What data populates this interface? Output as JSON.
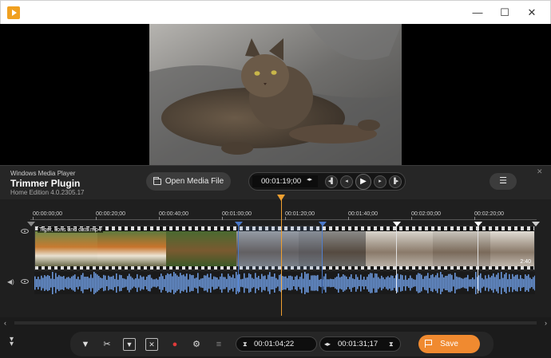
{
  "window": {
    "minimize_glyph": "—",
    "maximize_glyph": "☐",
    "close_glyph": "✕"
  },
  "brand": {
    "product": "Windows Media Player",
    "plugin": "Trimmer Plugin",
    "edition": "Home Edition 4.0.2305.17"
  },
  "controls": {
    "open_label": "Open Media File",
    "current_time": "00:01:19;00",
    "menu_glyph": "☰"
  },
  "timeline": {
    "ticks": [
      "00:00:00;00",
      "00:00:20;00",
      "00:00:40;00",
      "00:01:00;00",
      "00:01:20;00",
      "00:01:40;00",
      "00:02:00;00",
      "00:02:20;00"
    ],
    "clip_name": "Tiger, lions and cats.mp4",
    "clip_duration": "2:40"
  },
  "selection": {
    "start": "00:01:04;22",
    "end": "00:01:31;17"
  },
  "save_label": "Save",
  "colors": {
    "accent": "#f08a30",
    "playhead": "#f0a030",
    "selection_marker": "#4a78c8",
    "waveform": "#6a96d8"
  },
  "icons": [
    "app-icon",
    "folder-icon",
    "frame-step-back-icon",
    "step-back-icon",
    "play-icon",
    "step-forward-icon",
    "frame-step-forward-icon",
    "menu-icon",
    "eye-icon",
    "speaker-icon",
    "filter-icon",
    "cut-icon",
    "trim-icon",
    "mute-icon",
    "record-icon",
    "settings-icon",
    "equalizer-icon",
    "flag-icon",
    "collapse-icon"
  ]
}
